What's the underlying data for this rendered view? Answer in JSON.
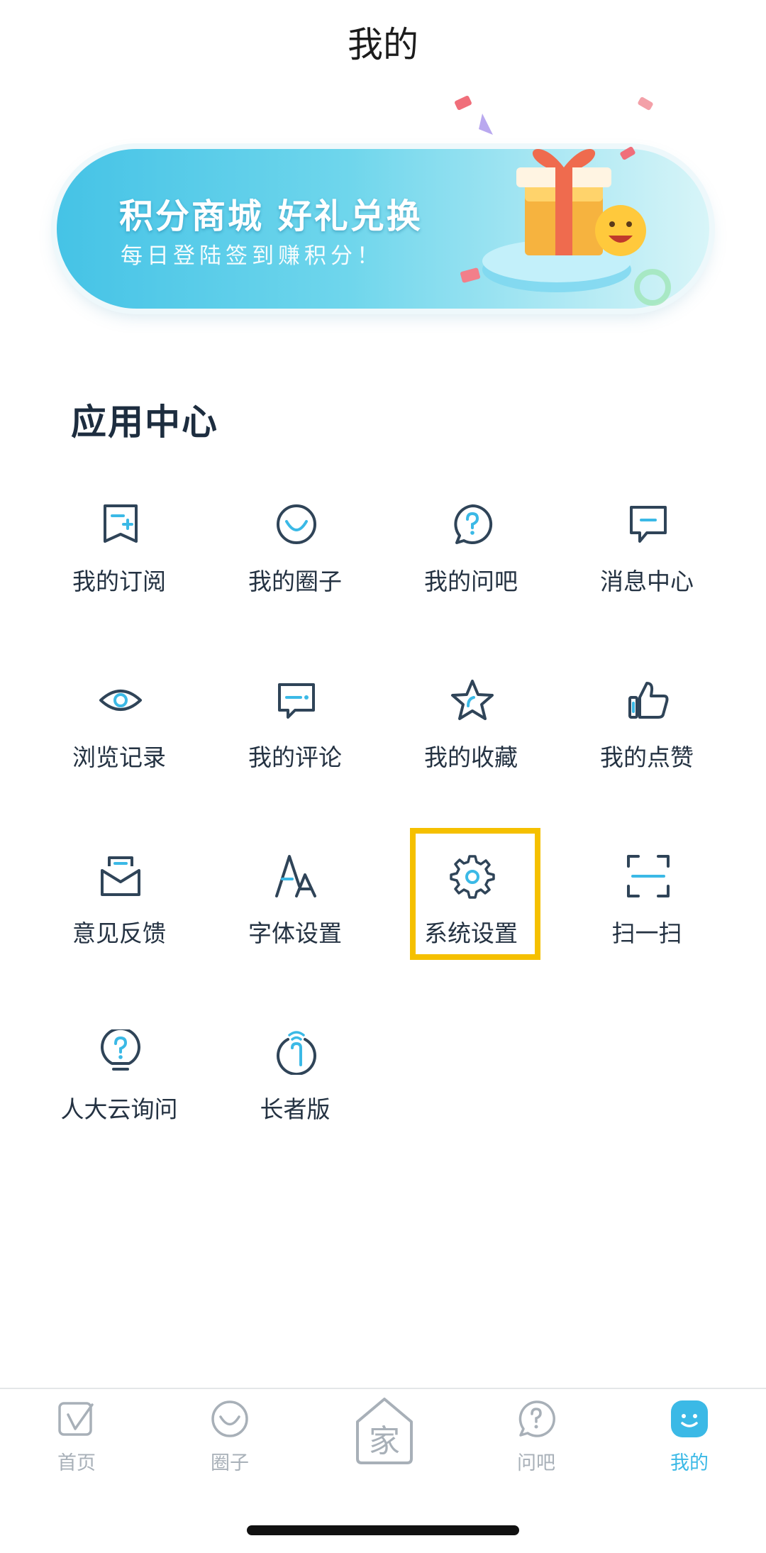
{
  "header": {
    "title": "我的"
  },
  "banner": {
    "title": "积分商城 好礼兑换",
    "subtitle": "每日登陆签到赚积分！"
  },
  "app_center": {
    "heading": "应用中心",
    "items": [
      {
        "label": "我的订阅",
        "icon": "subscribe-icon"
      },
      {
        "label": "我的圈子",
        "icon": "circle-icon"
      },
      {
        "label": "我的问吧",
        "icon": "question-bubble-icon"
      },
      {
        "label": "消息中心",
        "icon": "message-icon"
      },
      {
        "label": "浏览记录",
        "icon": "eye-icon"
      },
      {
        "label": "我的评论",
        "icon": "comment-icon"
      },
      {
        "label": "我的收藏",
        "icon": "star-icon"
      },
      {
        "label": "我的点赞",
        "icon": "thumbs-up-icon"
      },
      {
        "label": "意见反馈",
        "icon": "feedback-mail-icon"
      },
      {
        "label": "字体设置",
        "icon": "font-icon"
      },
      {
        "label": "系统设置",
        "icon": "gear-icon"
      },
      {
        "label": "扫一扫",
        "icon": "scan-icon"
      },
      {
        "label": "人大云询问",
        "icon": "help-bulb-icon"
      },
      {
        "label": "长者版",
        "icon": "elder-mode-icon"
      }
    ],
    "highlighted": "系统设置"
  },
  "tabbar": {
    "tabs": [
      {
        "label": "首页",
        "icon": "home-tab-icon"
      },
      {
        "label": "圈子",
        "icon": "circle-tab-icon"
      },
      {
        "label": "家",
        "icon": "family-house-icon"
      },
      {
        "label": "问吧",
        "icon": "question-tab-icon"
      },
      {
        "label": "我的",
        "icon": "smile-tab-icon",
        "active": true
      }
    ]
  },
  "colors": {
    "accent": "#3bb9e6",
    "icon_dark": "#2f4458",
    "icon_accent": "#3bb9e6",
    "highlight": "#f5c000",
    "tab_inactive": "#a8b0b8"
  }
}
